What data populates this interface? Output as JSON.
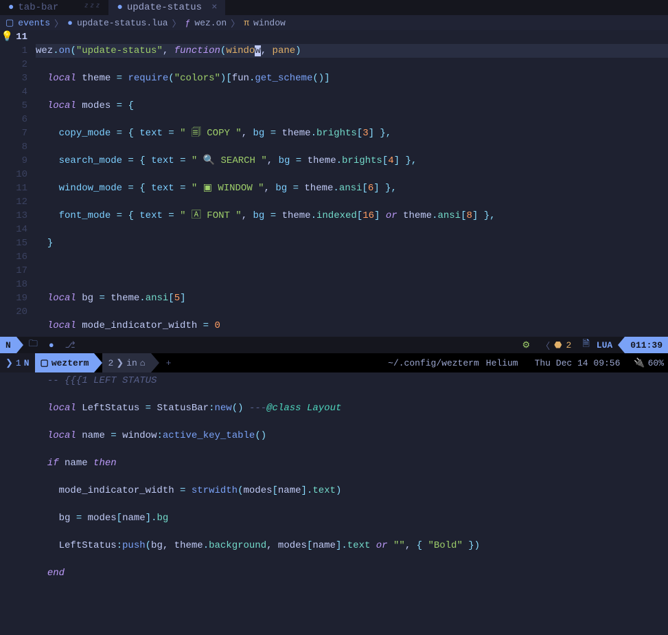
{
  "tabs": {
    "inactive": {
      "icon": "●",
      "label": "tab-bar",
      "sleepy": "ᶻᶻᶻ"
    },
    "active": {
      "icon": "●",
      "label": "update-status",
      "close": "×"
    }
  },
  "breadcrumb": {
    "folder_icon": "▢",
    "folder": "events",
    "file_icon": "●",
    "file": "update-status.lua",
    "func_icon": "ƒ",
    "func": "wez.on",
    "param_icon": "π",
    "param": "window"
  },
  "gutter": {
    "bulb": "💡",
    "current": "11",
    "lines": [
      "1",
      "2",
      "3",
      "4",
      "5",
      "6",
      "7",
      "8",
      "9",
      "10",
      "11",
      "12",
      "13",
      "14",
      "15",
      "16",
      "17",
      "18",
      "19",
      "20"
    ]
  },
  "code": {
    "l0": {
      "wez": "wez",
      "dot": ".",
      "on": "on",
      "po": "(",
      "str": "\"update-status\"",
      "comma": ", ",
      "func": "function",
      "po2": "(",
      "p1a": "windo",
      "p1b": "w",
      "c2": ", ",
      "p2": "pane",
      "pc": ")"
    },
    "l1": {
      "kw": "local",
      "v": "theme",
      "eq": " = ",
      "fn": "require",
      "po": "(",
      "s": "\"colors\"",
      "pc": ")",
      "br": "[",
      "obj": "fun",
      "dot": ".",
      "m": "get_scheme",
      "po2": "()",
      "bc": "]"
    },
    "l2": {
      "kw": "local",
      "v": "modes",
      "eq": " = ",
      "bo": "{"
    },
    "l3": {
      "f": "copy_mode",
      "eq": " = ",
      "bo": "{ ",
      "tk": "text",
      "e2": " = ",
      "s": "\" 🗐 COPY \"",
      "c": ", ",
      "bk": "bg",
      "e3": " = ",
      "o": "theme",
      "d": ".",
      "m": "brights",
      "br": "[",
      "n": "3",
      "bc": "] ",
      "be": "},"
    },
    "l4": {
      "f": "search_mode",
      "eq": " = ",
      "bo": "{ ",
      "tk": "text",
      "e2": " = ",
      "s": "\" 🔍 SEARCH \"",
      "c": ", ",
      "bk": "bg",
      "e3": " = ",
      "o": "theme",
      "d": ".",
      "m": "brights",
      "br": "[",
      "n": "4",
      "bc": "] ",
      "be": "},"
    },
    "l5": {
      "f": "window_mode",
      "eq": " = ",
      "bo": "{ ",
      "tk": "text",
      "e2": " = ",
      "s": "\" ▣ WINDOW \"",
      "c": ", ",
      "bk": "bg",
      "e3": " = ",
      "o": "theme",
      "d": ".",
      "m": "ansi",
      "br": "[",
      "n": "6",
      "bc": "] ",
      "be": "},"
    },
    "l6": {
      "f": "font_mode",
      "eq": " = ",
      "bo": "{ ",
      "tk": "text",
      "e2": " = ",
      "s": "\" 🄰 FONT \"",
      "c": ", ",
      "bk": "bg",
      "e3": " = ",
      "o": "theme",
      "d": ".",
      "m": "indexed",
      "br": "[",
      "n": "16",
      "bc": "] ",
      "or": "or",
      "o2": " theme",
      "d2": ".",
      "m2": "ansi",
      "br2": "[",
      "n2": "8",
      "bc2": "] ",
      "be": "},"
    },
    "l7": {
      "bc": "}"
    },
    "l9": {
      "kw": "local",
      "v": "bg",
      "eq": " = ",
      "o": "theme",
      "d": ".",
      "m": "ansi",
      "br": "[",
      "n": "5",
      "bc": "]"
    },
    "l10": {
      "kw": "local",
      "v": "mode_indicator_width",
      "eq": " = ",
      "n": "0"
    },
    "l12": {
      "c": "-- {{{1 LEFT STATUS"
    },
    "l13": {
      "kw": "local",
      "v": "LeftStatus",
      "eq": " = ",
      "o": "StatusBar",
      "col": ":",
      "m": "new",
      "p": "() ",
      "c": "---",
      "doc": "@class",
      "ct": " Layout"
    },
    "l14": {
      "kw": "local",
      "v": "name",
      "eq": " = ",
      "o": "window",
      "col": ":",
      "m": "active_key_table",
      "p": "()"
    },
    "l15": {
      "kw": "if",
      "v": " name ",
      "kw2": "then"
    },
    "l16": {
      "v": "mode_indicator_width",
      "eq": " = ",
      "fn": "strwidth",
      "po": "(",
      "o": "modes",
      "br": "[",
      "v2": "name",
      "bc": "].",
      "m": "text",
      "pc": ")"
    },
    "l17": {
      "v": "bg",
      "eq": " = ",
      "o": "modes",
      "br": "[",
      "v2": "name",
      "bc": "].",
      "m": "bg"
    },
    "l18": {
      "o": "LeftStatus",
      "col": ":",
      "m": "push",
      "po": "(",
      "a1": "bg",
      "c1": ", ",
      "o2": "theme",
      "d": ".",
      "m2": "background",
      "c2": ", ",
      "o3": "modes",
      "br": "[",
      "v2": "name",
      "bc": "].",
      "m3": "text ",
      "or": "or",
      "s": " \"\"",
      "c3": ", ",
      "bo": "{ ",
      "s2": "\"Bold\"",
      "be": " }",
      "pc": ")"
    },
    "l19": {
      "kw": "end"
    }
  },
  "statusline": {
    "mode": "N",
    "folder_icon": "🗀",
    "oil_icon": "●",
    "git_icon": "⎇",
    "lsp_icon": "⚙",
    "diag_open": "〈",
    "diag_icon": "⬣",
    "diag_count": "2",
    "file_icon": "🗎",
    "filetype": "LUA",
    "position": "011:39"
  },
  "bottombar": {
    "session_icon": "❯",
    "session_num": "1",
    "nvim_icon": "N",
    "tab1_icon": "▢",
    "tab1": "wezterm",
    "tab2_num": "2",
    "tab2_icon": "❯",
    "tab2": "in",
    "tab2_home": "⌂",
    "add": "+",
    "path": "~/.config/wezterm",
    "host": "Helium",
    "date": "Thu Dec 14 09:56",
    "bat_icon": "🔌",
    "bat": "60%"
  }
}
